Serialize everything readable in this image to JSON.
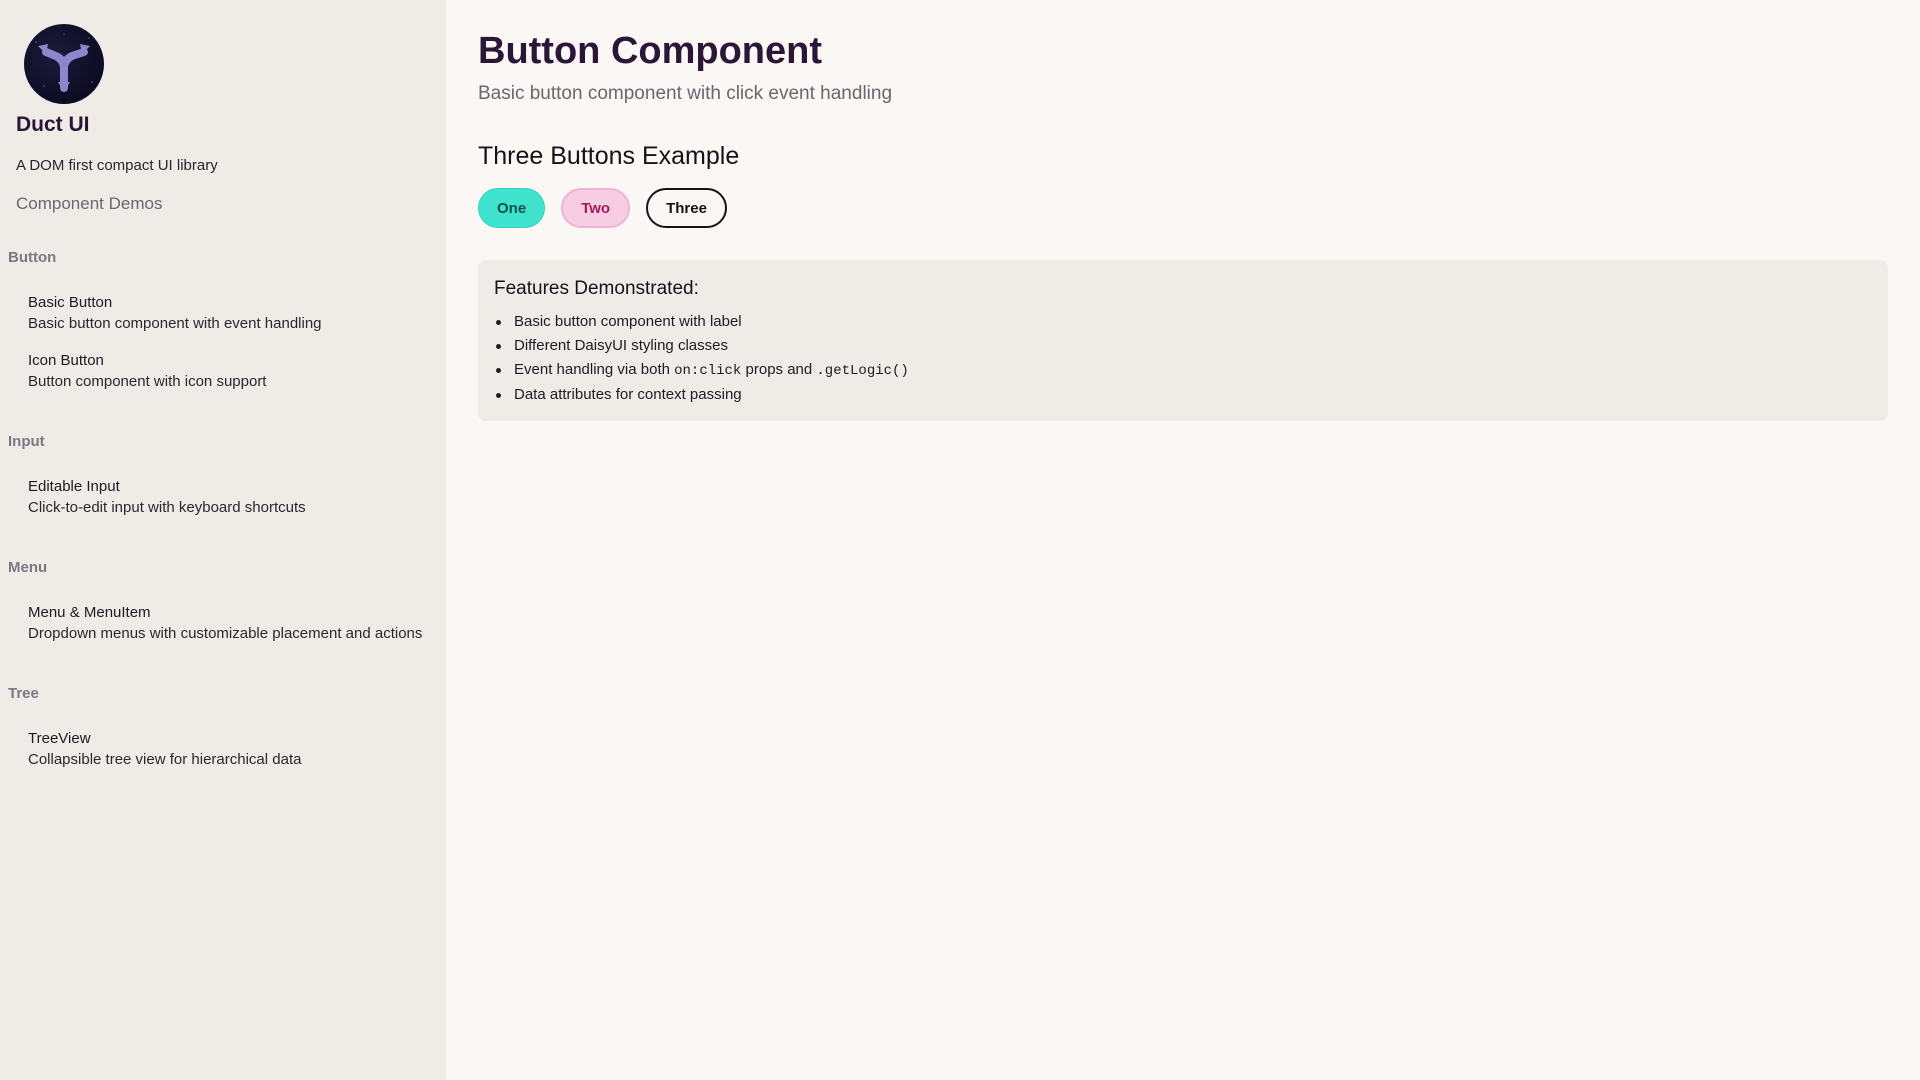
{
  "sidebar": {
    "brand_title": "Duct UI",
    "tagline": "A DOM first compact UI library",
    "demos_link": "Component Demos",
    "groups": [
      {
        "heading": "Button",
        "items": [
          {
            "title": "Basic Button",
            "desc": "Basic button component with event handling"
          },
          {
            "title": "Icon Button",
            "desc": "Button component with icon support"
          }
        ]
      },
      {
        "heading": "Input",
        "items": [
          {
            "title": "Editable Input",
            "desc": "Click-to-edit input with keyboard shortcuts"
          }
        ]
      },
      {
        "heading": "Menu",
        "items": [
          {
            "title": "Menu & MenuItem",
            "desc": "Dropdown menus with customizable placement and actions"
          }
        ]
      },
      {
        "heading": "Tree",
        "items": [
          {
            "title": "TreeView",
            "desc": "Collapsible tree view for hierarchical data"
          }
        ]
      }
    ]
  },
  "main": {
    "title": "Button Component",
    "subtitle": "Basic button component with click event handling",
    "section_title": "Three Buttons Example",
    "buttons": [
      {
        "label": "One",
        "color": "#3fe3cd"
      },
      {
        "label": "Two",
        "color": "#f7cde4"
      },
      {
        "label": "Three",
        "color": "#faf7f4"
      }
    ],
    "features": {
      "title": "Features Demonstrated:",
      "items": [
        {
          "text": "Basic button component with label"
        },
        {
          "text": "Different DaisyUI styling classes"
        },
        {
          "pre": "Event handling via both ",
          "code1": "on:click",
          "mid": " props and ",
          "code2": ".getLogic()"
        },
        {
          "text": "Data attributes for context passing"
        }
      ]
    }
  },
  "icons": {
    "logo": "split-arrows-icon"
  }
}
